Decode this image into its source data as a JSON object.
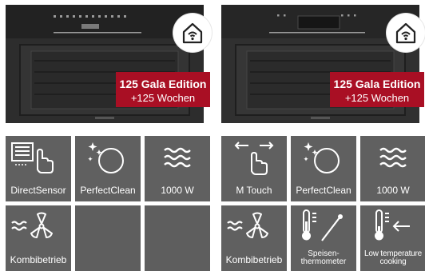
{
  "products": [
    {
      "badge": {
        "line1": "125 Gala Edition",
        "line2": "+125 Wochen"
      },
      "smart_icon": "smart-home-wifi-icon",
      "features": [
        {
          "label": "DirectSensor",
          "icon": "direct-sensor-icon"
        },
        {
          "label": "PerfectClean",
          "icon": "perfect-clean-icon"
        },
        {
          "label": "1000 W",
          "icon": "heat-waves-icon"
        },
        {
          "label": "Kombibetrieb",
          "icon": "combination-mode-icon"
        },
        {
          "label": "",
          "icon": ""
        },
        {
          "label": "",
          "icon": ""
        }
      ]
    },
    {
      "badge": {
        "line1": "125 Gala Edition",
        "line2": "+125 Wochen"
      },
      "smart_icon": "smart-home-wifi-icon",
      "features": [
        {
          "label": "M Touch",
          "icon": "touch-swipe-icon"
        },
        {
          "label": "PerfectClean",
          "icon": "perfect-clean-icon"
        },
        {
          "label": "1000 W",
          "icon": "heat-waves-icon"
        },
        {
          "label": "Kombibetrieb",
          "icon": "combination-mode-icon"
        },
        {
          "label": "Speisen-\nthermometer",
          "icon": "food-thermometer-icon"
        },
        {
          "label": "Low temperature cooking",
          "icon": "low-temperature-icon"
        }
      ]
    }
  ],
  "colors": {
    "badge": "#a90f24",
    "tile": "#606060",
    "oven_body": "#2b2b2b"
  }
}
